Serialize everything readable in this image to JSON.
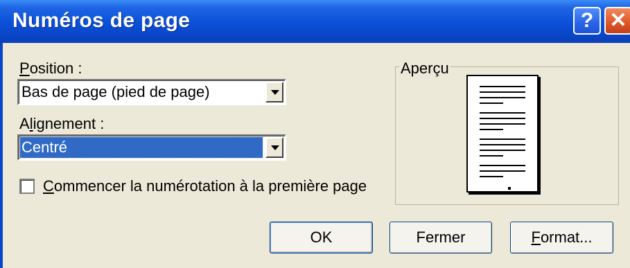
{
  "window": {
    "title": "Numéros de page",
    "help_glyph": "?",
    "close_glyph": "✕"
  },
  "position": {
    "label_first": "P",
    "label_rest": "osition :",
    "value": "Bas de page (pied de page)"
  },
  "alignment": {
    "label_first": "A",
    "label_mid": "l",
    "label_rest": "ignement :",
    "value": "Centré"
  },
  "first_page": {
    "label_first": "C",
    "label_rest": "ommencer la numérotation à la première page",
    "checked": false
  },
  "preview": {
    "legend": "Aperçu"
  },
  "buttons": {
    "ok": "OK",
    "close": "Fermer",
    "format_first": "F",
    "format_rest": "ormat..."
  }
}
